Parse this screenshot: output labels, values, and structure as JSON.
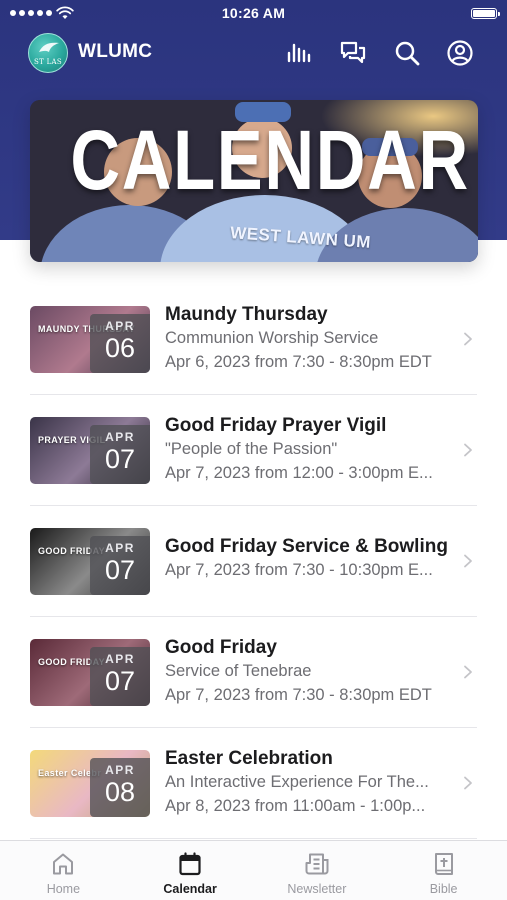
{
  "status": {
    "time": "10:26 AM"
  },
  "app": {
    "title": "WLUMC",
    "logo_text": "ST LAS"
  },
  "header_icons": [
    "chart-bars-icon",
    "chat-bubbles-icon",
    "search-icon",
    "profile-icon"
  ],
  "hero": {
    "title": "CALENDAR",
    "jersey_text": "WEST LAWN UM"
  },
  "events": [
    {
      "title": "Maundy Thursday",
      "line1": "Communion Worship Service",
      "line2": "Apr 6, 2023 from 7:30 - 8:30pm EDT",
      "month": "APR",
      "day": "06",
      "thumb_text": "MAUNDY THURSDAY",
      "thumb_colors": [
        "#6b4a63",
        "#b07a8e",
        "#3d2f44"
      ]
    },
    {
      "title": "Good Friday Prayer Vigil",
      "line1": "\"People of the Passion\"",
      "line2": "Apr 7, 2023 from 12:00 - 3:00pm E...",
      "month": "APR",
      "day": "07",
      "thumb_text": "PRAYER VIGIL",
      "thumb_colors": [
        "#3a3448",
        "#8d7a96",
        "#1f1a26"
      ]
    },
    {
      "title": "Good Friday Service & Bowling",
      "line1": "",
      "line2": "Apr 7, 2023 from 7:30 - 10:30pm E...",
      "month": "APR",
      "day": "07",
      "thumb_text": "GOOD FRIDAY",
      "thumb_colors": [
        "#1a1a1a",
        "#8a8a8a",
        "#2a2a2a"
      ]
    },
    {
      "title": "Good Friday",
      "line1": "Service of Tenebrae",
      "line2": "Apr 7, 2023 from 7:30 - 8:30pm EDT",
      "month": "APR",
      "day": "07",
      "thumb_text": "GOOD FRIDAY",
      "thumb_colors": [
        "#5a2a38",
        "#9e6a78",
        "#3a1c26"
      ]
    },
    {
      "title": "Easter Celebration",
      "line1": "An Interactive Experience For The...",
      "line2": "Apr 8, 2023 from 11:00am - 1:00p...",
      "month": "APR",
      "day": "08",
      "thumb_text": "Easter Celebr",
      "thumb_colors": [
        "#f3d97a",
        "#e9b8c4",
        "#b9a36a"
      ]
    }
  ],
  "tabs": [
    {
      "label": "Home",
      "icon": "home-icon",
      "active": false
    },
    {
      "label": "Calendar",
      "icon": "calendar-icon",
      "active": true
    },
    {
      "label": "Newsletter",
      "icon": "newsletter-icon",
      "active": false
    },
    {
      "label": "Bible",
      "icon": "bible-icon",
      "active": false
    }
  ],
  "colors": {
    "header_bg": "#2f3784",
    "text_primary": "#1c1c1e",
    "text_secondary": "#6d6d72",
    "tab_inactive": "#9a9aa0"
  }
}
